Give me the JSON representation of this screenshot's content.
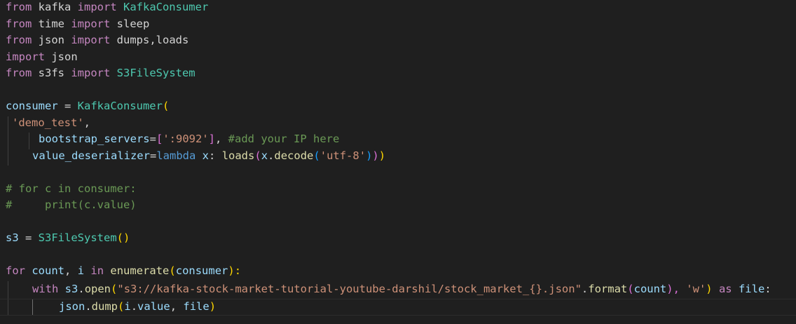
{
  "editor": {
    "lines": {
      "l1": [
        "from",
        " kafka ",
        "import",
        " KafkaConsumer"
      ],
      "l2": [
        "from",
        " time ",
        "import",
        " sleep"
      ],
      "l3": [
        "from",
        " json ",
        "import",
        " dumps,loads"
      ],
      "l4": [
        "import",
        " json"
      ],
      "l5": [
        "from",
        " s3fs ",
        "import",
        " S3FileSystem"
      ],
      "l7": [
        "consumer",
        " = ",
        "KafkaConsumer",
        "("
      ],
      "l8": [
        "'demo_test'",
        ","
      ],
      "l9": [
        "bootstrap_servers",
        "=",
        "[",
        "':9092'",
        "]",
        ", ",
        "#add your IP here"
      ],
      "l10": [
        "value_deserializer",
        "=",
        "lambda",
        " ",
        "x",
        ": ",
        "loads",
        "(",
        "x",
        ".",
        "decode",
        "(",
        "'utf-8'",
        ")",
        ")",
        ")"
      ],
      "l12": [
        "# for c in consumer:"
      ],
      "l13": [
        "#     print(c.value)"
      ],
      "l15": [
        "s3",
        " = ",
        "S3FileSystem",
        "()"
      ],
      "l17": [
        "for",
        " ",
        "count",
        ", ",
        "i",
        " ",
        "in",
        " ",
        "enumerate",
        "(",
        "consumer",
        "):"
      ],
      "l18": [
        "with",
        " ",
        "s3",
        ".",
        "open",
        "(",
        "\"s3://kafka-stock-market-tutorial-youtube-darshil/stock_market_{}.json\"",
        ".",
        "format",
        "(",
        "count",
        "), ",
        "'w'",
        ") ",
        "as",
        " ",
        "file",
        ":"
      ],
      "l19": [
        "json",
        ".",
        "dump",
        "(",
        "i",
        ".",
        "value",
        ", ",
        "file",
        ")"
      ]
    }
  }
}
